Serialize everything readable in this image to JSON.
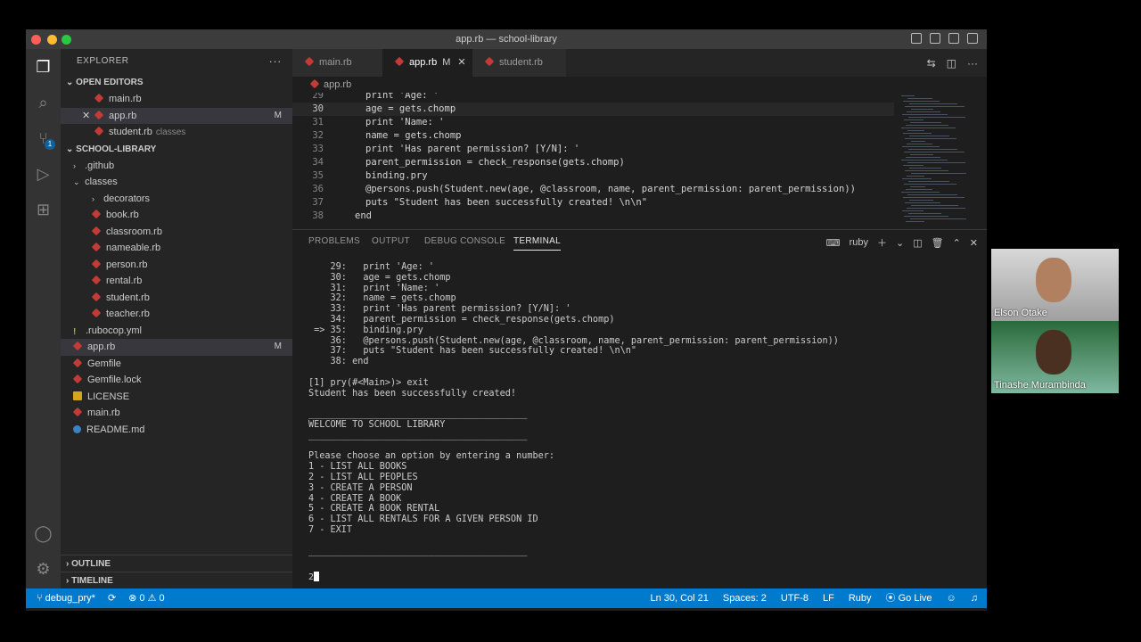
{
  "window": {
    "title": "app.rb — school-library"
  },
  "sidebar": {
    "header": "EXPLORER",
    "open_editors_label": "OPEN EDITORS",
    "open_editors": [
      {
        "name": "main.rb",
        "hint": "",
        "flag": ""
      },
      {
        "name": "app.rb",
        "hint": "",
        "flag": "M"
      },
      {
        "name": "student.rb",
        "hint": "classes",
        "flag": ""
      }
    ],
    "project_label": "SCHOOL-LIBRARY",
    "tree": [
      {
        "name": ".github",
        "kind": "folder",
        "flag": ""
      },
      {
        "name": "classes",
        "kind": "folder-open",
        "flag": ""
      },
      {
        "name": "decorators",
        "kind": "folder-child",
        "flag": ""
      },
      {
        "name": "book.rb",
        "kind": "ruby-child",
        "flag": ""
      },
      {
        "name": "classroom.rb",
        "kind": "ruby-child",
        "flag": ""
      },
      {
        "name": "nameable.rb",
        "kind": "ruby-child",
        "flag": ""
      },
      {
        "name": "person.rb",
        "kind": "ruby-child",
        "flag": ""
      },
      {
        "name": "rental.rb",
        "kind": "ruby-child",
        "flag": ""
      },
      {
        "name": "student.rb",
        "kind": "ruby-child",
        "flag": ""
      },
      {
        "name": "teacher.rb",
        "kind": "ruby-child",
        "flag": ""
      },
      {
        "name": ".rubocop.yml",
        "kind": "yml",
        "flag": ""
      },
      {
        "name": "app.rb",
        "kind": "ruby",
        "flag": "M"
      },
      {
        "name": "Gemfile",
        "kind": "ruby",
        "flag": ""
      },
      {
        "name": "Gemfile.lock",
        "kind": "ruby",
        "flag": ""
      },
      {
        "name": "LICENSE",
        "kind": "license",
        "flag": ""
      },
      {
        "name": "main.rb",
        "kind": "ruby",
        "flag": ""
      },
      {
        "name": "README.md",
        "kind": "info",
        "flag": ""
      }
    ],
    "outline_label": "OUTLINE",
    "timeline_label": "TIMELINE"
  },
  "tabs": [
    {
      "label": "main.rb",
      "modified": "",
      "active": false
    },
    {
      "label": "app.rb",
      "modified": "M",
      "active": true
    },
    {
      "label": "student.rb",
      "modified": "",
      "active": false
    }
  ],
  "breadcrumb": "app.rb",
  "editor": {
    "lines": [
      {
        "n": "29",
        "code": "print 'Age: '"
      },
      {
        "n": "30",
        "code": "age = gets.chomp"
      },
      {
        "n": "31",
        "code": "print 'Name: '"
      },
      {
        "n": "32",
        "code": "name = gets.chomp"
      },
      {
        "n": "33",
        "code": "print 'Has parent permission? [Y/N]: '"
      },
      {
        "n": "34",
        "code": "parent_permission = check_response(gets.chomp)"
      },
      {
        "n": "35",
        "code": "binding.pry"
      },
      {
        "n": "36",
        "code": "@persons.push(Student.new(age, @classroom, name, parent_permission: parent_permission))"
      },
      {
        "n": "37",
        "code": "puts \"Student has been successfully created! \\n\\n\""
      },
      {
        "n": "38",
        "code": "end"
      }
    ]
  },
  "panel": {
    "tabs": [
      "PROBLEMS",
      "OUTPUT",
      "DEBUG CONSOLE",
      "TERMINAL"
    ],
    "active_tab": "TERMINAL",
    "terminal_shell": "ruby"
  },
  "terminal": {
    "lines": [
      "    29:   print 'Age: '",
      "    30:   age = gets.chomp",
      "    31:   print 'Name: '",
      "    32:   name = gets.chomp",
      "    33:   print 'Has parent permission? [Y/N]: '",
      "    34:   parent_permission = check_response(gets.chomp)",
      " => 35:   binding.pry",
      "    36:   @persons.push(Student.new(age, @classroom, name, parent_permission: parent_permission))",
      "    37:   puts \"Student has been successfully created! \\n\\n\"",
      "    38: end",
      "",
      "[1] pry(#<Main>)> exit",
      "Student has been successfully created!",
      "",
      "________________________________________",
      "WELCOME TO SCHOOL LIBRARY",
      "________________________________________",
      "",
      "Please choose an option by entering a number:",
      "1 - LIST ALL BOOKS",
      "2 - LIST ALL PEOPLES",
      "3 - CREATE A PERSON",
      "4 - CREATE A BOOK",
      "5 - CREATE A BOOK RENTAL",
      "6 - LIST ALL RENTALS FOR A GIVEN PERSON ID",
      "7 - EXIT",
      "",
      "________________________________________"
    ],
    "prompt_input": "2"
  },
  "statusbar": {
    "branch": "debug_pry*",
    "problems": "⊗ 0 ⚠ 0",
    "position": "Ln 30, Col 21",
    "spaces": "Spaces: 2",
    "encoding": "UTF-8",
    "eol": "LF",
    "language": "Ruby",
    "go_live": "Go Live"
  },
  "participants": [
    {
      "name": "Elson Otake"
    },
    {
      "name": "Tinashe Murambinda"
    }
  ]
}
